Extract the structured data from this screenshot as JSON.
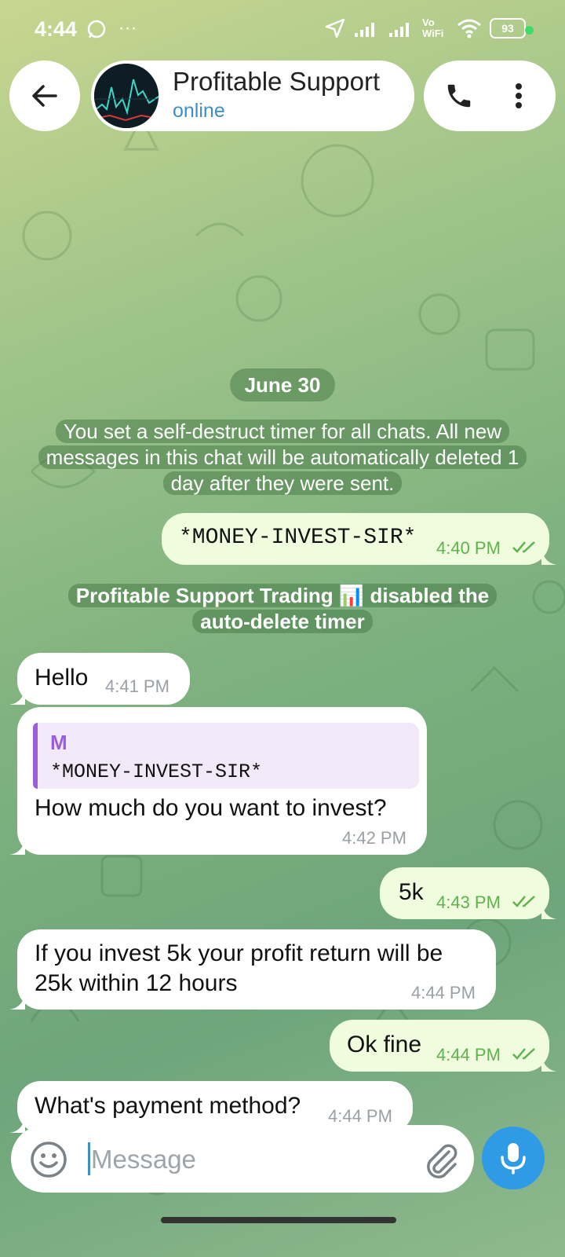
{
  "status_bar": {
    "time": "4:44",
    "left_icons": "whatsapp-icon, more-icon",
    "network_label": "Vo WiFi",
    "battery": "93"
  },
  "header": {
    "name": "Profitable Support",
    "status": "online"
  },
  "date_separator": "June 30",
  "service_messages": {
    "timer_set": "You set a self-destruct timer for all chats. All new messages in this chat will be automatically deleted 1 day after they were sent.",
    "timer_disabled": "Profitable Support Trading 📊 disabled the auto-delete timer"
  },
  "messages": [
    {
      "direction": "out",
      "text": "*MONEY-INVEST-SIR*",
      "time": "4:40 PM",
      "read": true
    },
    {
      "direction": "in",
      "text": "Hello",
      "time": "4:41 PM"
    },
    {
      "direction": "in",
      "reply_name": "M",
      "reply_text": "*MONEY-INVEST-SIR*",
      "text": "How much do you want to invest?",
      "time": "4:42 PM"
    },
    {
      "direction": "out",
      "text": "5k",
      "time": "4:43 PM",
      "read": true
    },
    {
      "direction": "in",
      "text_line1": "If you invest 5k your profit return will be",
      "text_line2": "25k within 12 hours",
      "time": "4:44 PM"
    },
    {
      "direction": "out",
      "text": "Ok fine",
      "time": "4:44 PM",
      "read": true
    },
    {
      "direction": "in",
      "text": "What's payment method?",
      "time": "4:44 PM"
    }
  ],
  "composer": {
    "placeholder": "Message"
  },
  "colors": {
    "accent": "#2f9be6",
    "outgoing_bubble": "#effdde",
    "incoming_bubble": "#ffffff",
    "read_ticks": "#5fb24d",
    "reply_accent": "#9a5fd6"
  }
}
